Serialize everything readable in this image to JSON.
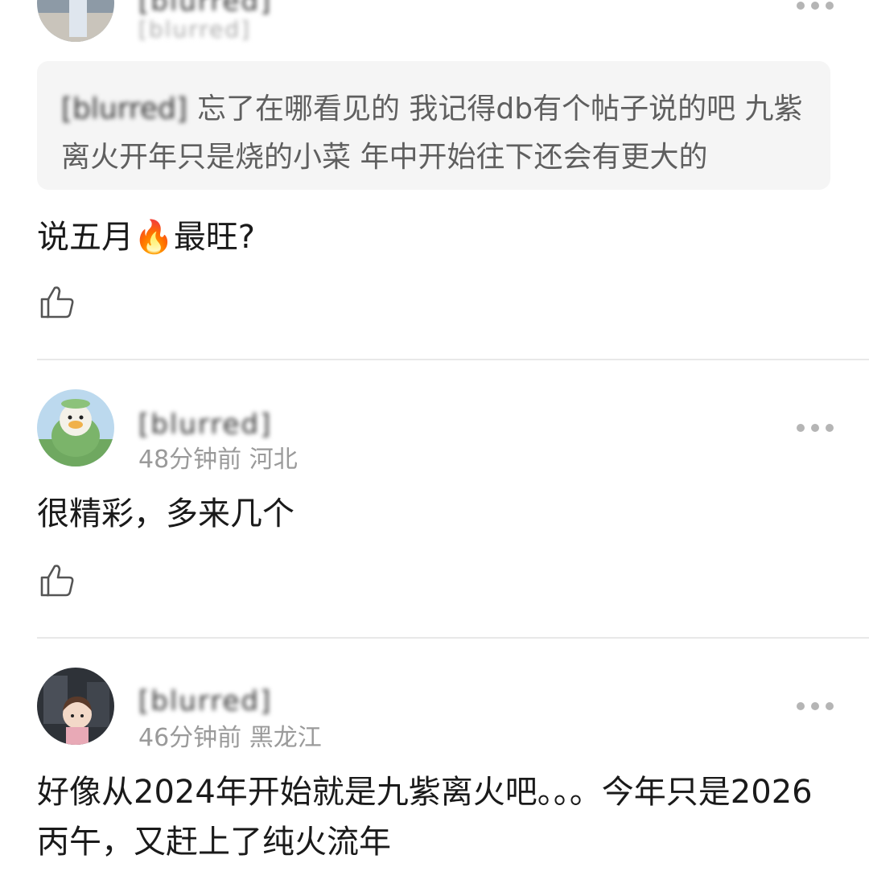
{
  "comments": [
    {
      "username": "[blurred]",
      "meta": "[blurred]",
      "quote_user": "[blurred]",
      "quote_text": "忘了在哪看见的 我记得db有个帖子说的吧 九紫离火开年只是烧的小菜 年中开始往下还会有更大的",
      "text_before_emoji": "说五月",
      "emoji": "🔥",
      "text_after_emoji": "最旺?"
    },
    {
      "username": "[blurred]",
      "meta": "48分钟前 河北",
      "text": "很精彩，多来几个"
    },
    {
      "username": "[blurred]",
      "meta": "46分钟前 黑龙江",
      "text": "好像从2024年开始就是九紫离火吧。。。今年只是2026丙午，又赶上了纯火流年"
    }
  ],
  "icons": {
    "like": "thumbs-up-icon",
    "more": "more-dots-icon",
    "fire": "fire-emoji"
  },
  "colors": {
    "meta_gray": "#9a9a9a",
    "quote_bg": "#f5f5f5",
    "divider": "#e8e8e8"
  }
}
